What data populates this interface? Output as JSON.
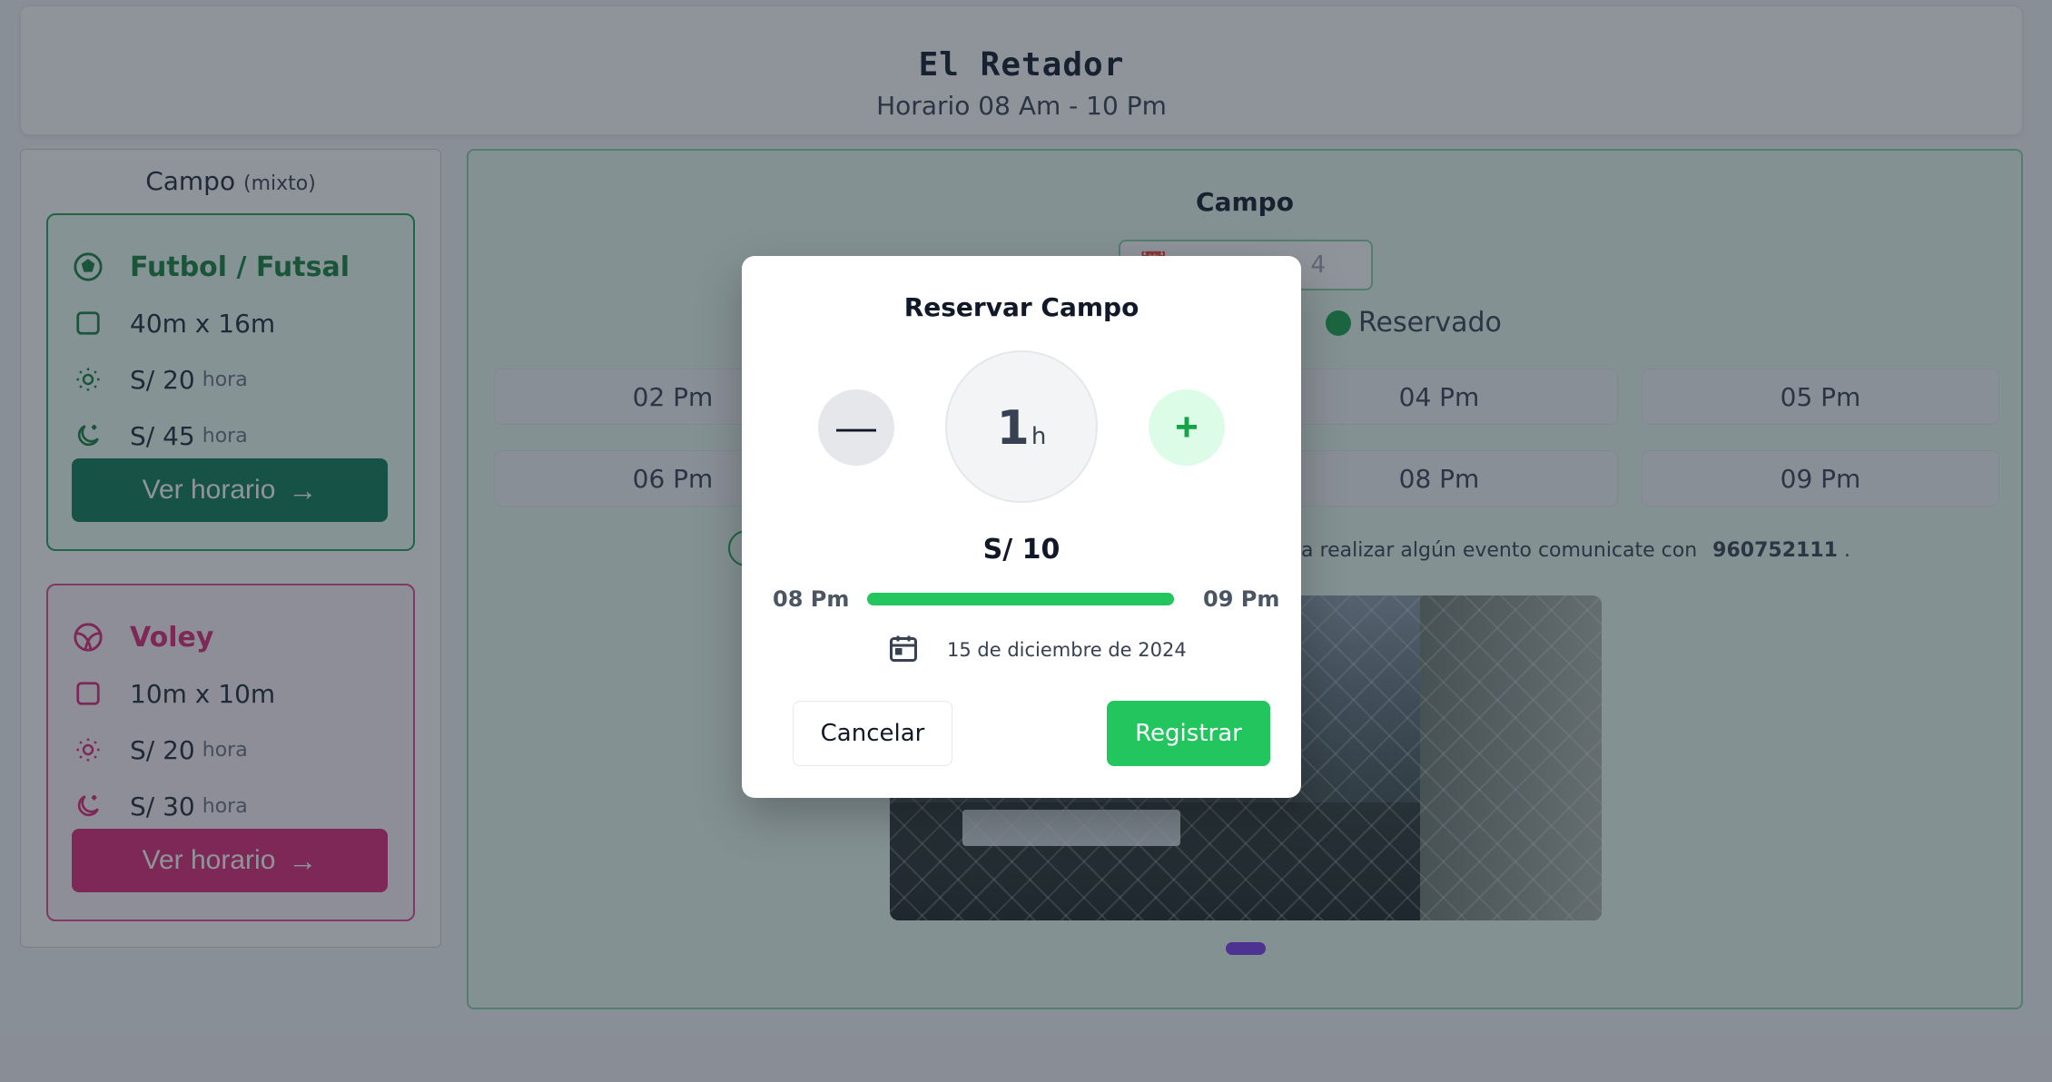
{
  "header": {
    "title": "El Retador",
    "schedule": "Horario 08 Am - 10 Pm"
  },
  "sidebar": {
    "title": "Campo",
    "title_note": "(mixto)",
    "cards": [
      {
        "sport": "Futbol / Futsal",
        "size": "40m x 16m",
        "day_price": "S/ 20",
        "night_price": "S/ 45",
        "unit": "hora",
        "button": "Ver horario",
        "color": "#15803d"
      },
      {
        "sport": "Voley",
        "size": "10m x 10m",
        "day_price": "S/ 20",
        "night_price": "S/ 30",
        "unit": "hora",
        "button": "Ver horario",
        "color": "#db2777"
      }
    ]
  },
  "main": {
    "title": "Campo",
    "date_value": "4",
    "legend_reserved": "Reservado",
    "slots": [
      "02 Pm",
      "04 Pm",
      "05 Pm",
      "06 Pm",
      "08 Pm",
      "09 Pm"
    ],
    "info_text": "ra realizar algún evento comunicate con",
    "info_phone": "960752111",
    "info_end": ".",
    "carousel_color": "#7c3aed"
  },
  "modal": {
    "title": "Reservar Campo",
    "decrease_label": "—",
    "increase_label": "+",
    "hours": "1",
    "hours_unit": "h",
    "price": "S/ 10",
    "start_time": "08 Pm",
    "end_time": "09 Pm",
    "progress": 1.0,
    "date": "15 de diciembre de 2024",
    "cancel_label": "Cancelar",
    "register_label": "Registrar",
    "accent": "#22c55e"
  }
}
